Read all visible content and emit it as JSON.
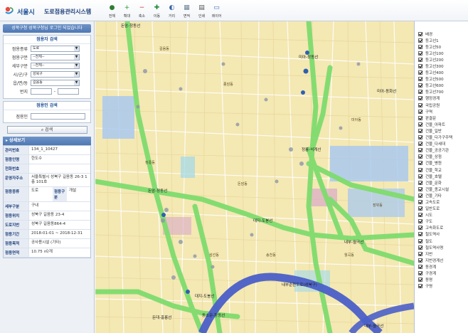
{
  "header": {
    "brand": "서울시",
    "title": "도로점용관리시스템",
    "tools": [
      {
        "label": "전체",
        "icon": "globe-icon",
        "color": "#2e7d32",
        "glyph": "●"
      },
      {
        "label": "확대",
        "icon": "zoom-in-icon",
        "color": "#2e9d36",
        "glyph": "+"
      },
      {
        "label": "축소",
        "icon": "zoom-out-icon",
        "color": "#d0342c",
        "glyph": "−"
      },
      {
        "label": "이동",
        "icon": "pan-icon",
        "color": "#1e8a3a",
        "glyph": "✚"
      },
      {
        "label": "거리",
        "icon": "distance-icon",
        "color": "#3a62a8",
        "glyph": "◐"
      },
      {
        "label": "면적",
        "icon": "area-icon",
        "color": "#6b7d96",
        "glyph": "▦"
      },
      {
        "label": "인쇄",
        "icon": "print-icon",
        "color": "#555555",
        "glyph": "▤"
      },
      {
        "label": "레이어",
        "icon": "layer-icon",
        "color": "#3d6db5",
        "glyph": "▭"
      }
    ]
  },
  "left": {
    "user_banner": "성북구청 성북구청님 로그인 되었습니다",
    "search": {
      "title": "점용자 검색",
      "fields": [
        {
          "label": "점용종류",
          "value": "도로"
        },
        {
          "label": "점용구분",
          "value": "--전체--"
        },
        {
          "label": "세부구분",
          "value": "--전체--"
        },
        {
          "label": "시/군/구",
          "value": "성북구"
        },
        {
          "label": "읍/면/동",
          "value": "길음동"
        }
      ],
      "bunji_label": "번지",
      "bunji_sep": "-"
    },
    "name_search": {
      "title": "점용인 검색",
      "label": "점용인"
    },
    "search_button": "검색",
    "detail": {
      "title": "상세보기",
      "rows": [
        {
          "key": "관리번호",
          "value": "134_1_10427"
        },
        {
          "key": "점용인명",
          "value": "한도수"
        },
        {
          "key": "전화번호",
          "value": ""
        },
        {
          "key": "운영자주소",
          "value": "서울특별시 성북구 길음동 26-3 1층 101호"
        },
        {
          "key": "점용종류",
          "value": "도로",
          "key2": "점용구분",
          "value2": "개설"
        },
        {
          "key": "세부구분",
          "value": "구내"
        },
        {
          "key": "점용위치",
          "value": "성북구 길음동 23-4"
        },
        {
          "key": "도로지번",
          "value": "성북구 길음동864-4"
        },
        {
          "key": "점용기간",
          "value": "2018-01-01 ~ 2018-12-31"
        },
        {
          "key": "점용목적",
          "value": "공사용시설 (기타)"
        },
        {
          "key": "점용면적",
          "value": "10.75 ㎡/개"
        }
      ]
    }
  },
  "layers": [
    "배경",
    "등고선1",
    "등고선50",
    "등고선100",
    "등고선200",
    "등고선300",
    "등고선400",
    "등고선500",
    "등고선600",
    "등고선700",
    "행정경계",
    "국립공원",
    "구역",
    "판결문",
    "건물_아파트",
    "건물_일반",
    "건물_다가구주택",
    "건물_다세대",
    "건물_공공기관",
    "건물_상점",
    "건물_병원",
    "건물_학교",
    "건물_호텔",
    "건물_문화",
    "건물_종교시설",
    "건물_기타",
    "고속도로",
    "일반도로",
    "시도",
    "구도",
    "고속화도로",
    "철도역사",
    "철도",
    "철도역사명",
    "지번",
    "지번경계선",
    "동경계",
    "구경계",
    "동명",
    "구명"
  ],
  "map": {
    "stations": [
      "돈암-창동선",
      "미아-창동선",
      "대지-도봉선",
      "미아-동화선",
      "정릉-석계선",
      "내부-월곡선",
      "내부순환도로(성북구)",
      "동소문-창동선",
      "돈대-홍릉선"
    ],
    "labels": [
      "길음동",
      "종암동",
      "정릉동",
      "돈암동",
      "월곡동",
      "송천동",
      "삼선동",
      "미아동",
      "장위동"
    ]
  },
  "colors": {
    "accent": "#4f78b4",
    "road_green": "#7fdc6e",
    "road_blue": "#4a5fc8",
    "map_bg": "#f4e8b3"
  }
}
